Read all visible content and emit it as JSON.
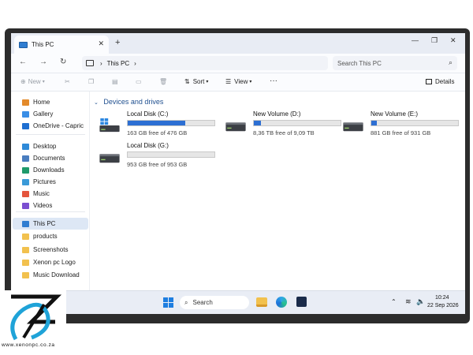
{
  "window": {
    "tab_title": "This PC",
    "tab_close": "✕",
    "new_tab": "+",
    "minimize": "—",
    "maximize": "❐",
    "close": "✕"
  },
  "nav": {
    "back": "←",
    "forward": "→",
    "refresh": "↻",
    "address": "This PC",
    "search_placeholder": "Search This PC"
  },
  "commands": {
    "new": "New",
    "sort": "Sort",
    "view": "View",
    "more": "···",
    "details": "Details"
  },
  "sidebar": {
    "items": [
      {
        "label": "Home",
        "color": "#e38a2b"
      },
      {
        "label": "Gallery",
        "color": "#3a8ee6"
      },
      {
        "label": "OneDrive - Capric",
        "color": "#1f6fd1"
      },
      {
        "label": "Desktop",
        "color": "#2f8ad8"
      },
      {
        "label": "Documents",
        "color": "#4a7dbf"
      },
      {
        "label": "Downloads",
        "color": "#1f9a6b"
      },
      {
        "label": "Pictures",
        "color": "#3a9ad8"
      },
      {
        "label": "Music",
        "color": "#e4553d"
      },
      {
        "label": "Videos",
        "color": "#7b4fd1"
      },
      {
        "label": "This PC",
        "color": "#2f7dd1"
      },
      {
        "label": "products",
        "color": "#f2c14e"
      },
      {
        "label": "Screenshots",
        "color": "#f2c14e"
      },
      {
        "label": "Xenon pc Logo",
        "color": "#f2c14e"
      },
      {
        "label": "Music Download",
        "color": "#f2c14e"
      }
    ]
  },
  "main": {
    "group_title": "Devices and drives",
    "drives": [
      {
        "name": "Local Disk (C:)",
        "free": "163 GB free of 476 GB",
        "used_fraction": 0.66,
        "windows": true
      },
      {
        "name": "New Volume (D:)",
        "free": "8,36 TB free of 9,09 TB",
        "used_fraction": 0.08,
        "windows": false
      },
      {
        "name": "New Volume (E:)",
        "free": "881 GB free of 931 GB",
        "used_fraction": 0.06,
        "windows": false
      },
      {
        "name": "Local Disk (G:)",
        "free": "953 GB free of 953 GB",
        "used_fraction": 0.0,
        "windows": false
      }
    ]
  },
  "taskbar": {
    "search": "Search",
    "time": "10:24",
    "date": "22 Sep 2026"
  },
  "brand": {
    "url": "www.xenonpc.co.za",
    "logo_color": "#1fa3d8"
  }
}
